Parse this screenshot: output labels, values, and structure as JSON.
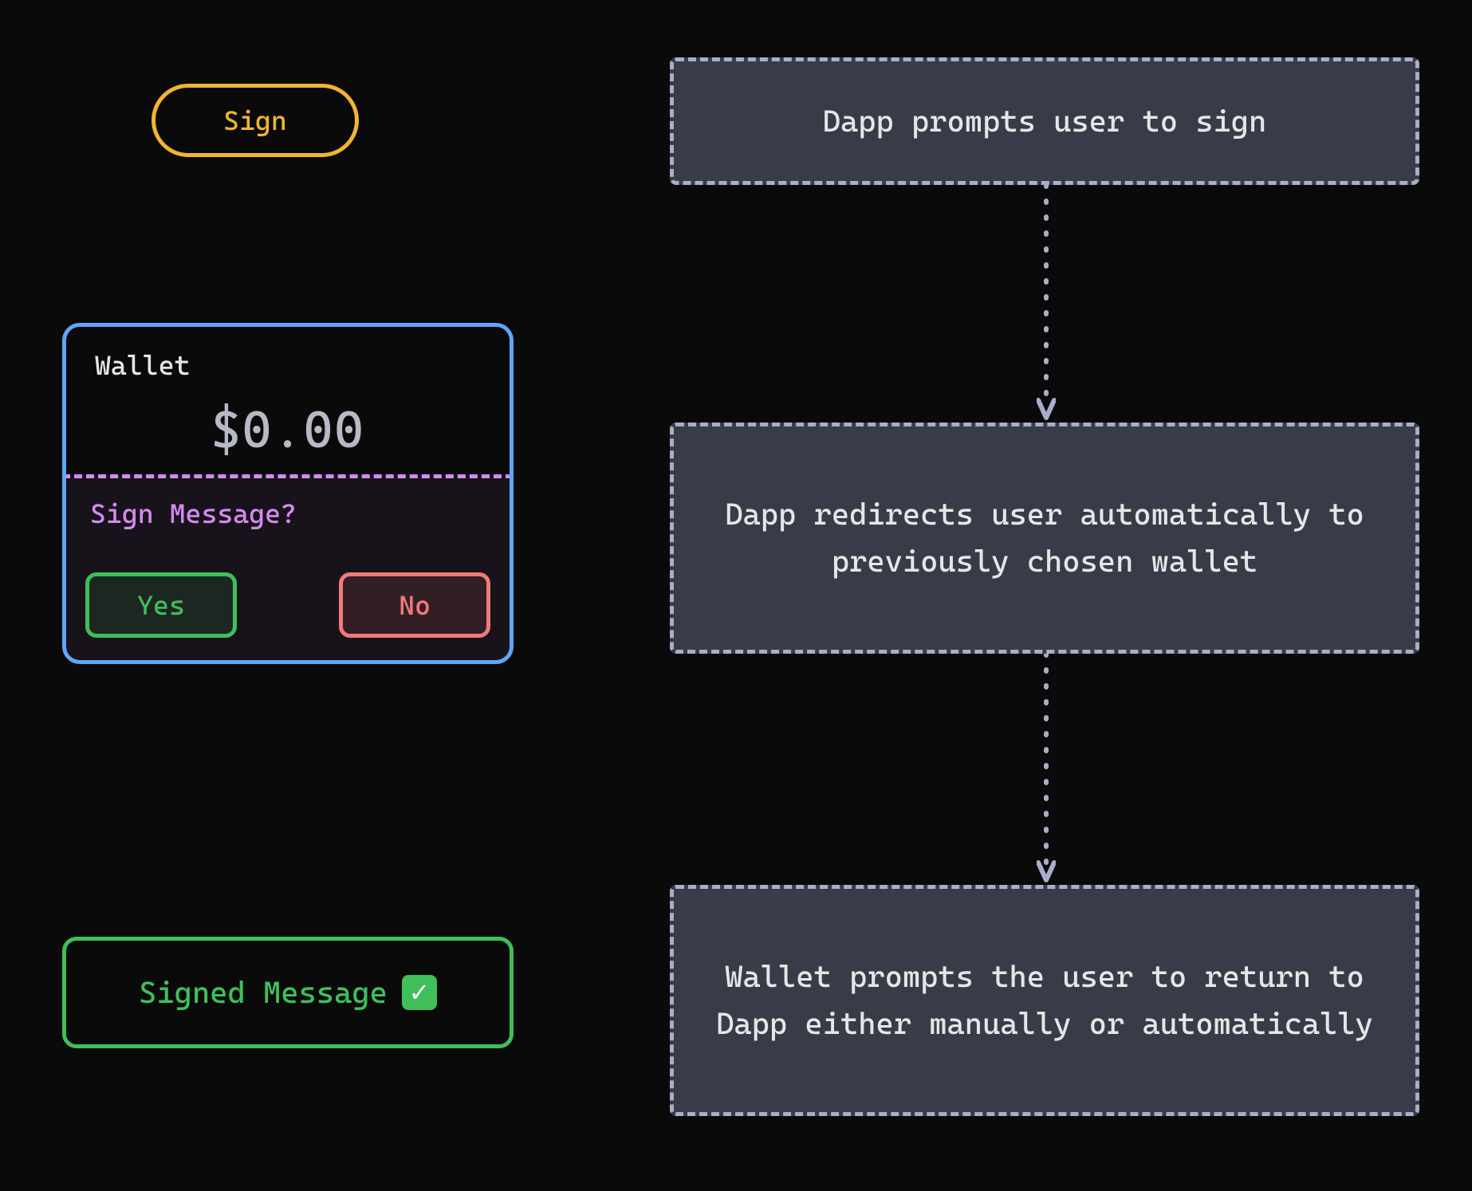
{
  "left": {
    "sign_button_label": "Sign",
    "wallet": {
      "title": "Wallet",
      "balance": "$0.00",
      "prompt_label": "Sign Message?",
      "yes_label": "Yes",
      "no_label": "No"
    },
    "signed_message_label": "Signed Message"
  },
  "flow": {
    "step1": "Dapp prompts user to sign",
    "step2": "Dapp redirects user automatically to previously chosen wallet",
    "step3": "Wallet prompts the user to return to Dapp either manually or automatically"
  },
  "colors": {
    "accent_gold": "#f2b431",
    "accent_blue": "#61a5f9",
    "accent_purple": "#d58af0",
    "accent_green": "#3fbf5a",
    "accent_red": "#f17a7a",
    "neutral": "#a8aecb"
  }
}
